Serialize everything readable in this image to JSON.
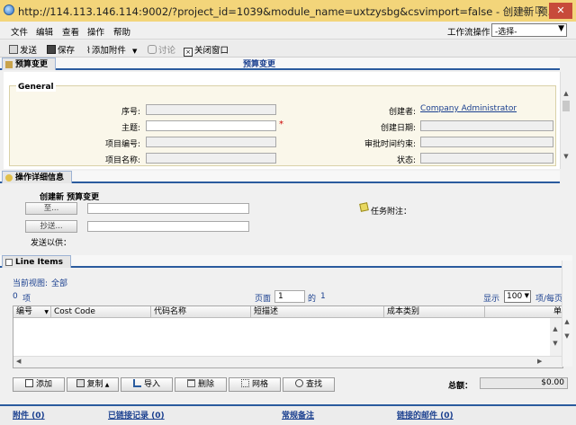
{
  "window": {
    "title": "http://114.113.146.114:9002/?project_id=1039&module_name=uxtzysbg&csvimport=false - 创建新 预...",
    "controls": {
      "minimize": "–",
      "maximize": "☐",
      "close": "✕"
    }
  },
  "menu": {
    "items": [
      "文件",
      "编辑",
      "查看",
      "操作",
      "帮助"
    ],
    "workflow_label": "工作流操作",
    "workflow_select": "-选择-"
  },
  "toolbar": {
    "send": "发送",
    "save": "保存",
    "add_attachment": "添加附件",
    "discuss": "讨论",
    "close_window": "关闭窗口"
  },
  "budget_section": {
    "tab_label": "预算变更",
    "center_title": "预算变更",
    "group_label": "General",
    "fields_left": [
      {
        "label": "序号:",
        "value": "",
        "required": false
      },
      {
        "label": "主题:",
        "value": "",
        "required": true
      },
      {
        "label": "项目编号:",
        "value": "",
        "required": false
      },
      {
        "label": "项目名称:",
        "value": "",
        "required": false
      }
    ],
    "fields_right": [
      {
        "label": "创建者:",
        "value": "Company Administrator"
      },
      {
        "label": "创建日期:",
        "value": ""
      },
      {
        "label": "审批时间约束:",
        "value": ""
      },
      {
        "label": "状态:",
        "value": ""
      }
    ],
    "required_marker": "*"
  },
  "detail_section": {
    "tab_label": "操作详细信息",
    "create_title": "创建新 预算变更",
    "to_button": "至...",
    "cc_button": "抄送...",
    "send_for": "发送以供：",
    "task_note": "任务附注："
  },
  "line_items": {
    "tab_label": "Line Items",
    "current_view_label": "当前视图:",
    "current_view_value": "全部",
    "count": "0",
    "count_suffix": "项",
    "page_label": "页面",
    "page_value": "1",
    "of_label": "的",
    "total_pages": "1",
    "show_label": "显示",
    "per_page_value": "100",
    "per_page_label": "项/每页",
    "columns": [
      "编号",
      "Cost Code",
      "代码名称",
      "短描述",
      "成本类别",
      "单价"
    ],
    "buttons": [
      "添加",
      "复制",
      "导入",
      "删除",
      "网格",
      "查找"
    ],
    "total_label": "总额：",
    "total_value": "$0.00"
  },
  "footer": {
    "attachments": "附件 (0)",
    "linked_records": "已链接记录 (0)",
    "general_notes": "常规备注",
    "linked_mail": "链接的邮件 (0)"
  },
  "colors": {
    "titlebar": "#f3d57a",
    "section_rule": "#2a5b9e",
    "form_bg": "#faf7ea",
    "link": "#1a3f8f",
    "required": "#cc0000"
  }
}
